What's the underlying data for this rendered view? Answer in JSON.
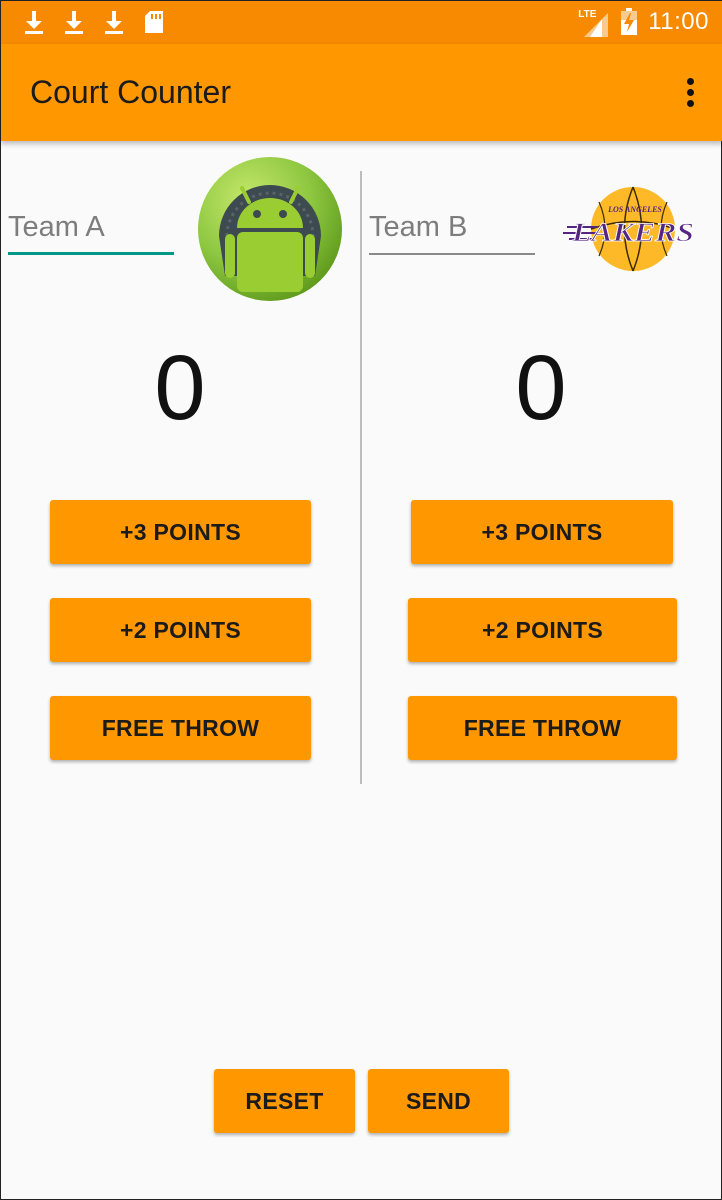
{
  "status_bar": {
    "time": "11:00",
    "network": "LTE",
    "icons": [
      "download-icon",
      "download-icon",
      "download-icon",
      "sd-card-icon",
      "signal-icon",
      "battery-charging-icon"
    ]
  },
  "app_bar": {
    "title": "Court Counter",
    "menu_icon": "overflow-menu-icon"
  },
  "team_a": {
    "name_placeholder": "Team A",
    "name_value": "",
    "logo": "android-logo",
    "score": "0",
    "buttons": {
      "three": "+3 POINTS",
      "two": "+2 POINTS",
      "free": "FREE THROW"
    }
  },
  "team_b": {
    "name_placeholder": "Team B",
    "name_value": "",
    "logo": "lakers-logo",
    "logo_text_top": "LOS ANGELES",
    "logo_text_main": "LAKERS",
    "score": "0",
    "buttons": {
      "three": "+3 POINTS",
      "two": "+2 POINTS",
      "free": "FREE THROW"
    }
  },
  "footer": {
    "reset": "RESET",
    "send": "SEND"
  },
  "colors": {
    "status_bar": "#f78a00",
    "app_bar": "#ff9800",
    "button": "#ff9800",
    "accent": "#009688",
    "background": "#fafafa"
  }
}
